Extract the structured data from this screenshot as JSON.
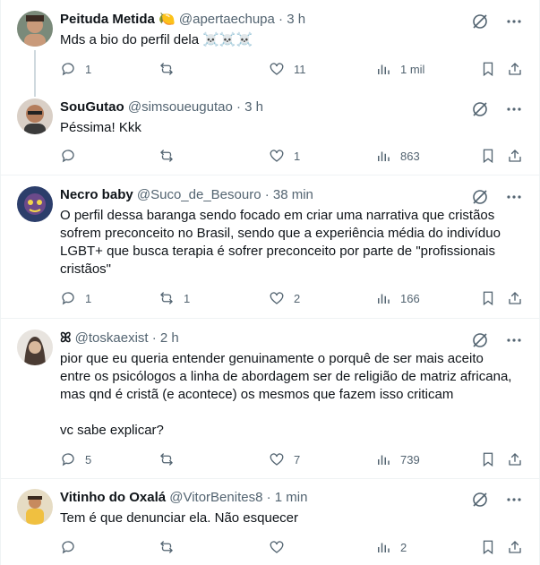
{
  "tweets": [
    {
      "name": "Peituda Metida 🍋",
      "handle": "@apertaechupa",
      "time": "3 h",
      "text": [
        "Mds a bio do perfil dela ☠️☠️☠️"
      ],
      "replies": "1",
      "retweets": "",
      "likes": "11",
      "views": "1 mil"
    },
    {
      "name": "SouGutao",
      "handle": "@simsoueugutao",
      "time": "3 h",
      "text": [
        "Péssima! Kkk"
      ],
      "replies": "",
      "retweets": "",
      "likes": "1",
      "views": "863"
    },
    {
      "name": "Necro baby",
      "handle": "@Suco_de_Besouro",
      "time": "38 min",
      "text": [
        "O perfil dessa baranga sendo focado em criar uma narrativa que cristãos",
        "sofrem preconceito no Brasil, sendo que a experiência média do indivíduo",
        "LGBT+ que busca terapia é sofrer preconceito por parte de \"profissionais",
        "cristãos\""
      ],
      "replies": "1",
      "retweets": "1",
      "likes": "2",
      "views": "166"
    },
    {
      "name": "ꕤ",
      "handle": "@toskaexist",
      "time": "2 h",
      "text": [
        "pior que eu queria entender genuinamente o porquê de ser mais aceito",
        "entre os psicólogos a linha de abordagem ser de religião de matriz africana,",
        "mas qnd é cristã (e acontece) os mesmos que fazem isso criticam",
        "",
        "vc sabe explicar?"
      ],
      "replies": "5",
      "retweets": "",
      "likes": "7",
      "views": "739"
    },
    {
      "name": "Vitinho do Oxalá",
      "handle": "@VitorBenites8",
      "time": "1 min",
      "text": [
        "Tem é que denunciar ela. Não esquecer"
      ],
      "replies": "",
      "retweets": "",
      "likes": "",
      "views": "2"
    }
  ],
  "ui": {
    "dot": "·"
  },
  "colors": {
    "text": "#0f1419",
    "muted": "#536471",
    "divider": "#eff3f4",
    "thread": "#cfd9de"
  }
}
